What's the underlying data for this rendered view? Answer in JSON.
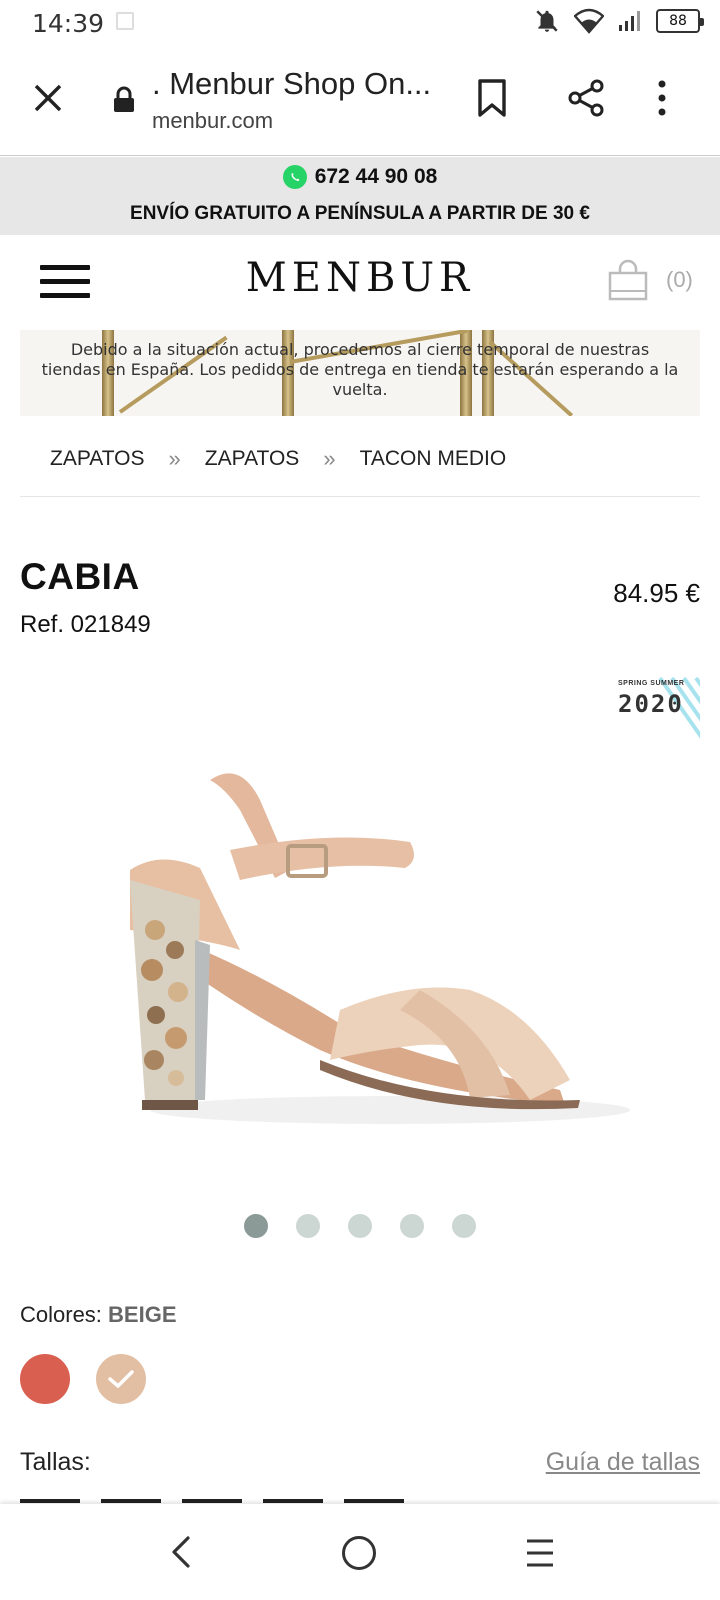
{
  "status_bar": {
    "time": "14:39",
    "battery": "88"
  },
  "browser": {
    "title": ". Menbur Shop On...",
    "domain": "menbur.com"
  },
  "promo": {
    "phone": "672 44 90 08",
    "shipping": "ENVÍO GRATUITO A PENÍNSULA A PARTIR DE 30 €"
  },
  "header": {
    "logo": "MENBUR",
    "cart_count": "(0)"
  },
  "notice": {
    "text": "Debido a la situación actual, procedemos al cierre temporal de nuestras tiendas en España. Los pedidos de entrega en tienda te estarán esperando a la vuelta."
  },
  "breadcrumb": {
    "items": [
      "ZAPATOS",
      "ZAPATOS",
      "TACON MEDIO"
    ],
    "separator": "»"
  },
  "product": {
    "name": "CABIA",
    "ref": "Ref. 021849",
    "price": "84.95 €",
    "badge_small": "SPRING SUMMER",
    "badge_year": "2020",
    "colors_label": "Colores:",
    "selected_color": "BEIGE",
    "swatch_colors": {
      "red": "#d95f50",
      "beige": "#e2bfa3"
    },
    "sizes_label": "Tallas:",
    "size_guide": "Guía de tallas"
  }
}
